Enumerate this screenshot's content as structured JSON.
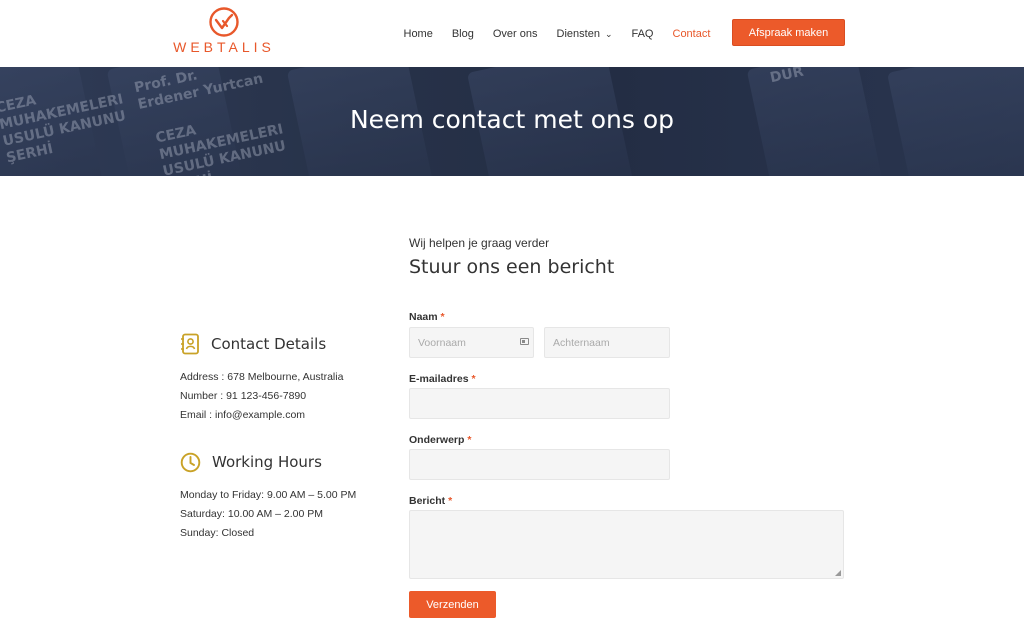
{
  "brand": {
    "name": "WEBTALIS",
    "accent": "#ec5a2a"
  },
  "nav": {
    "items": [
      {
        "label": "Home"
      },
      {
        "label": "Blog"
      },
      {
        "label": "Over ons"
      },
      {
        "label": "Diensten"
      },
      {
        "label": "FAQ"
      },
      {
        "label": "Contact"
      }
    ],
    "cta": "Afspraak maken"
  },
  "hero": {
    "title": "Neem contact met ons op",
    "book_texts": [
      "CEZA\nMUHAKEMELERI\nUSULÜ KANUNU\nŞERHİ",
      "Prof. Dr.\nErdener Yurtcan",
      "CEZA\nMUHAKEMELERI\nUSULÜ KANUNU\nŞERHİ",
      "DUR"
    ]
  },
  "contact": {
    "title": "Contact Details",
    "address": "Address :  678 Melbourne, Australia",
    "number": "Number : 91 123-456-7890",
    "email": "Email : info@example.com"
  },
  "hours": {
    "title": "Working Hours",
    "line1": "Monday to Friday: 9.00 AM – 5.00 PM",
    "line2": "Saturday: 10.00 AM – 2.00 PM",
    "line3": "Sunday: Closed"
  },
  "form": {
    "subtitle": "Wij helpen je graag verder",
    "title": "Stuur ons een bericht",
    "name_label": "Naam",
    "first_placeholder": "Voornaam",
    "last_placeholder": "Achternaam",
    "email_label": "E-mailadres",
    "subject_label": "Onderwerp",
    "message_label": "Bericht",
    "required_mark": "*",
    "submit": "Verzenden"
  }
}
